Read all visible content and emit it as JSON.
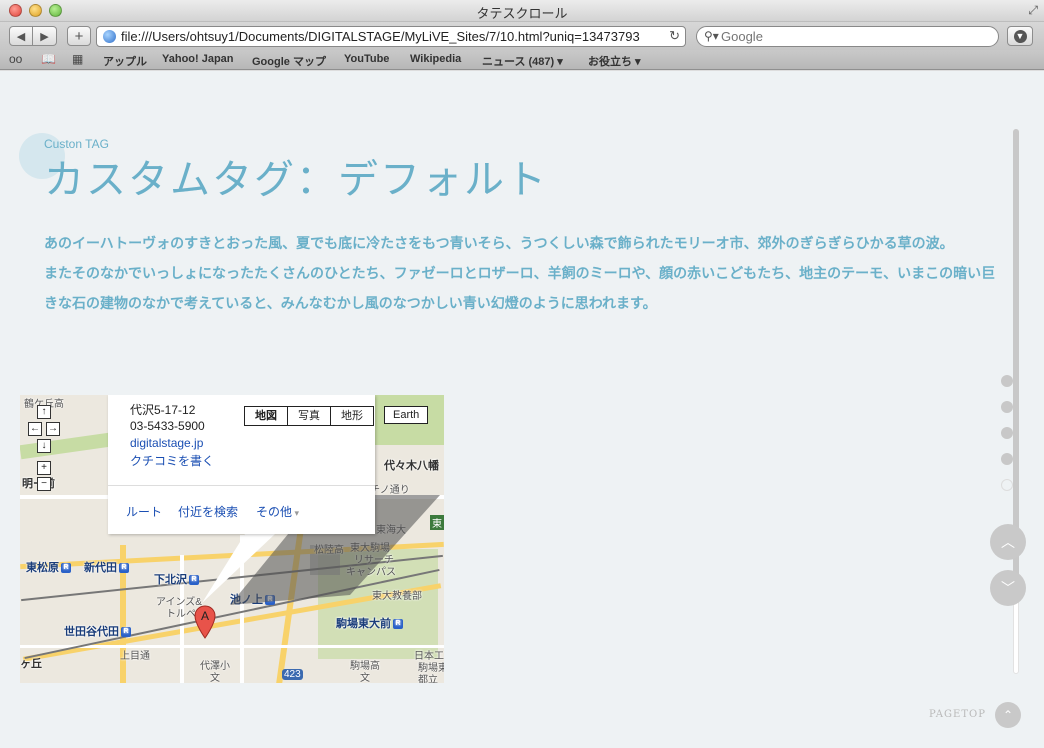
{
  "window": {
    "title": "タテスクロール"
  },
  "toolbar": {
    "url": "file:///Users/ohtsuy1/Documents/DIGITALSTAGE/MyLiVE_Sites/7/10.html?uniq=13473793",
    "search_placeholder": "Google",
    "add_label": "+"
  },
  "bookmarks": [
    "アップル",
    "Yahoo! Japan",
    "Google マップ",
    "YouTube",
    "Wikipedia",
    "ニュース (487) ▾",
    "お役立ち ▾"
  ],
  "content": {
    "subtitle": "Custon TAG",
    "title": "カスタムタグ：デフォルト",
    "paragraphs": [
      "あのイーハトーヴォのすきとおった風、夏でも底に冷たさをもつ青いそら、うつくしい森で飾られたモリーオ市、郊外のぎらぎらひかる草の波。",
      "またそのなかでいっしょになったたくさんのひとたち、ファゼーロとロザーロ、羊飼のミーロや、顔の赤いこどもたち、地主のテーモ、いまこの暗い巨きな石の建物のなかで考えていると、みんなむかし風のなつかしい青い幻燈のように思われます。"
    ]
  },
  "map": {
    "types": [
      "地図",
      "写真",
      "地形"
    ],
    "earth": "Earth",
    "info": {
      "address": "代沢5-17-12",
      "phone": "03-5433-5900",
      "website": "digitalstage.jp",
      "review": "クチコミを書く",
      "route": "ルート",
      "nearby": "付近を検索",
      "more": "その他"
    },
    "marker_label": "A",
    "labels": {
      "tsurugaoka": "鶴ケ丘高",
      "meiji": "明ー前",
      "higashimatsubara": "東松原",
      "shindaita": "新代田",
      "shimokitazawa": "下北沢",
      "ikenoue": "池ノ上",
      "setagayadaita": "世田谷代田",
      "umegaoka": "ヶ丘",
      "komaba_todaimae": "駒場東大前",
      "yoyogi_hachiman": "代々木八幡",
      "matsubara_hs": "松陸高",
      "todai_komaba": "東大駒場",
      "research": "リサーチ",
      "campus": "キャンパス",
      "todai_kyoiku": "東大教養部",
      "daizawa_sho": "代澤小",
      "komaba_hs": "駒場高",
      "ains": "アインズ&",
      "tolpe": "トルペ",
      "nihon_ko": "日本工",
      "komaba_ko": "駒場東",
      "toritsu": "都立",
      "shinodori": "チノ通り",
      "tokai": "東海大",
      "route423": "423",
      "bun1": "文",
      "bun2": "文",
      "tokyu": "東",
      "kamimeguro": "上目通"
    }
  },
  "pagetop": "PAGETOP"
}
